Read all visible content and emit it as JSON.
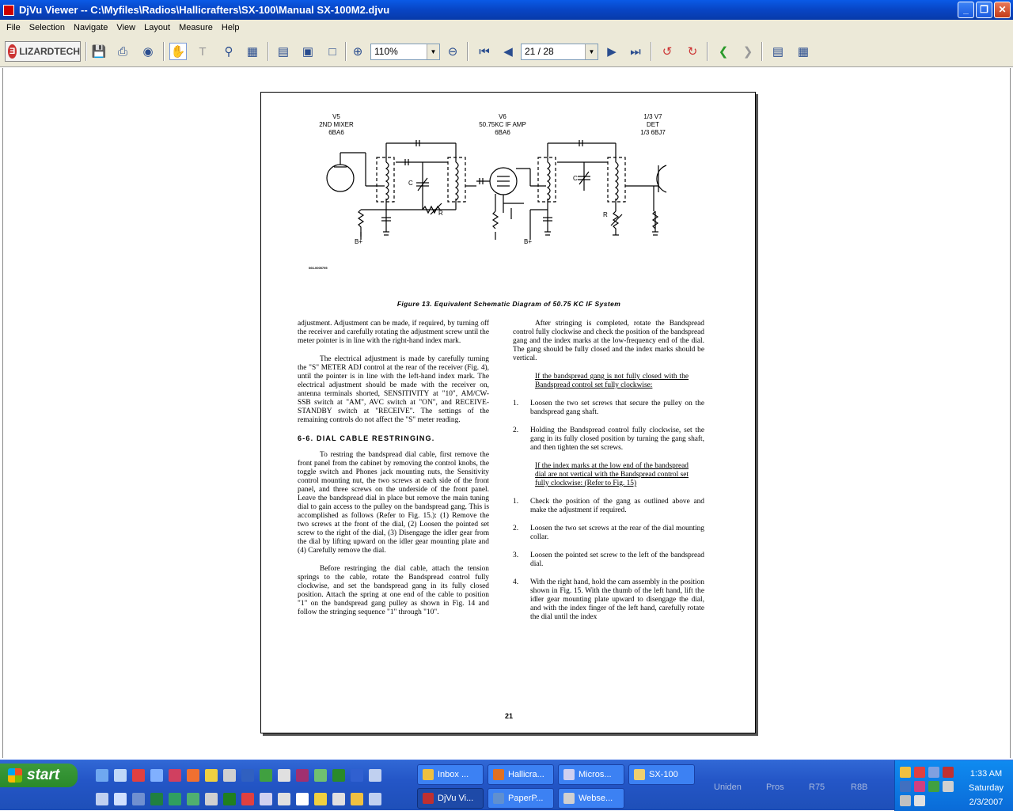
{
  "window": {
    "title": "DjVu Viewer -- C:\\Myfiles\\Radios\\Hallicrafters\\SX-100\\Manual SX-100M2.djvu",
    "minimize": "_",
    "maximize": "❐",
    "close": "✕"
  },
  "menu": [
    "File",
    "Selection",
    "Navigate",
    "View",
    "Layout",
    "Measure",
    "Help"
  ],
  "toolbar": {
    "logo": "LIZARDTECH",
    "zoom": "110%",
    "page": "21 / 28"
  },
  "schematic": {
    "v5": "V5\n2ND MIXER\n6BA6",
    "v6": "V6\n50.75KC IF AMP\n6BA6",
    "v7": "1/3 V7\nDET\n1/3 6BJ7",
    "c1": "C",
    "r1": "R",
    "c2": "C",
    "r2": "R",
    "bplus1": "B+",
    "bplus2": "B+",
    "partno": "066-0005795"
  },
  "figure_caption": "Figure 13.   Equivalent Schematic Diagram of 50.75 KC IF System",
  "left_column": {
    "p1": "adjustment. Adjustment can be made, if required, by turning off the receiver and carefully rotating the adjustment screw until the meter pointer is in line with the right-hand index mark.",
    "p2": "The electrical adjustment is made by carefully turning the \"S\" METER ADJ control at the rear of the receiver (Fig. 4), until the pointer is in line with the left-hand index mark. The electrical adjustment should be made with the receiver on, antenna terminals shorted, SENSITIVITY at \"10\", AM/CW-SSB switch at \"AM\", AVC switch at \"ON\", and RECEIVE-STANDBY switch at \"RECEIVE\". The settings of the remaining controls do not affect the \"S\" meter reading.",
    "heading": "6-6.   DIAL CABLE RESTRINGING.",
    "p3": "To restring the bandspread dial cable, first remove the front panel from the cabinet by removing the control knobs, the toggle switch and Phones jack mounting nuts, the Sensitivity control mounting nut, the two screws at each side of the front panel, and three screws on the underside of the front panel. Leave the bandspread dial in place but remove the main tuning dial to gain access to the pulley on the bandspread gang. This is accomplished as follows (Refer to Fig. 15.): (1) Remove the two screws at the front of the dial, (2) Loosen the pointed set screw to the right of the dial, (3) Disengage the idler gear from the dial by lifting upward on the idler gear mounting plate and (4) Carefully remove the dial.",
    "p4": "Before restringing the dial cable, attach the tension springs to the cable, rotate the Bandspread control fully clockwise, and set the bandspread gang in its fully closed position. Attach the spring at one end of the cable to position \"1\" on the bandspread gang pulley as shown in Fig. 14 and follow the stringing sequence \"1\" through \"10\"."
  },
  "right_column": {
    "p1": "After stringing is completed, rotate the Bandspread control fully clockwise and check the position of the bandspread gang and the index marks at the low-frequency end of the dial. The gang should be fully closed and the index marks should be vertical.",
    "u1": "If the bandspread gang is not fully closed with the Bandspread control set fully clockwise:",
    "list1": [
      {
        "n": "1.",
        "t": "Loosen the two set screws that secure the pulley on the bandspread gang shaft."
      },
      {
        "n": "2.",
        "t": "Holding the Bandspread control fully clockwise, set the gang in its fully closed position by turning the gang shaft, and then tighten the set screws."
      }
    ],
    "u2": "If the index marks at the low end of the bandspread dial are not vertical with the Bandspread control set fully clockwise:",
    "u2_suffix": " (Refer to Fig. 15)",
    "list2": [
      {
        "n": "1.",
        "t": "Check the position of the gang as outlined above and make the adjustment if required."
      },
      {
        "n": "2.",
        "t": "Loosen the two set screws at the rear of the dial mounting collar."
      },
      {
        "n": "3.",
        "t": "Loosen the pointed set screw to the left of the bandspread dial."
      },
      {
        "n": "4.",
        "t": "With the right hand, hold the cam assembly in the position shown in Fig. 15. With the thumb of the left hand, lift the idler gear mounting plate upward to disengage the dial, and with the index finger of the left hand, carefully rotate the dial until the index"
      }
    ]
  },
  "page_number": "21",
  "taskbar": {
    "start": "start",
    "tasks_top": [
      "Inbox ...",
      "Hallicra...",
      "Micros...",
      "SX-100"
    ],
    "tasks_bottom": [
      "DjVu Vi...",
      "PaperP...",
      "Webse..."
    ],
    "toolbars": [
      "Uniden",
      "Pros",
      "R75",
      "R8B"
    ],
    "clock": {
      "time": "1:33 AM",
      "day": "Saturday",
      "date": "2/3/2007"
    }
  }
}
